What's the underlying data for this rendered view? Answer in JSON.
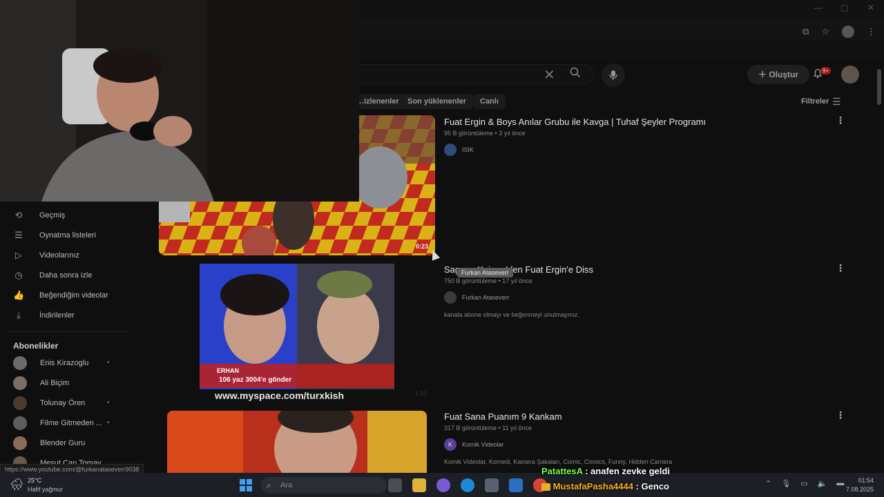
{
  "window": {
    "minimize": "—",
    "maximize": "▢",
    "close": "✕"
  },
  "search": {
    "clear_icon": "✕",
    "search_icon": "⌕"
  },
  "header": {
    "create_label": "Oluştur",
    "notifications_badge": "9+"
  },
  "filter_chips": [
    "…izlenenler",
    "Son yüklenenler",
    "Canlı"
  ],
  "filters_label": "Filtreler",
  "sidebar": {
    "items": [
      {
        "icon": "history-icon",
        "glyph": "⟲",
        "label": "Geçmiş"
      },
      {
        "icon": "playlist-icon",
        "glyph": "☰",
        "label": "Oynatma listeleri"
      },
      {
        "icon": "your-videos-icon",
        "glyph": "▷",
        "label": "Videolarınız"
      },
      {
        "icon": "watch-later-icon",
        "glyph": "◷",
        "label": "Daha sonra izle"
      },
      {
        "icon": "like-icon",
        "glyph": "👍",
        "label": "Beğendiğim videolar"
      },
      {
        "icon": "download-icon",
        "glyph": "⤓",
        "label": "İndirilenler"
      }
    ],
    "subscriptions_header": "Abonelikler",
    "subscriptions": [
      {
        "name": "Enis Kirazoglu",
        "dot": "•",
        "color": "#6b6b6b"
      },
      {
        "name": "Ali Biçim",
        "dot": "",
        "color": "#7a6f66"
      },
      {
        "name": "Tolunay Ören",
        "dot": "•",
        "color": "#4b3a2f"
      },
      {
        "name": "Filme Gitmeden ...",
        "dot": "•",
        "color": "#5d5d5d"
      },
      {
        "name": "Blender Guru",
        "dot": "",
        "color": "#8a6a58"
      },
      {
        "name": "Mesut Can Tomay",
        "dot": "",
        "color": "#6a5a4a"
      }
    ]
  },
  "videos": [
    {
      "title": "Fuat Ergin & Boys Anılar Grubu ile Kavga | Tuhaf Şeyler Programı",
      "meta": "95 B görüntüleme • 3 yıl önce",
      "channel": "ISIK",
      "duration": "0:23",
      "description": ""
    },
    {
      "title": "Sagopa Kajmer'den Fuat Ergin'e Diss",
      "meta": "750 B görüntüleme • 17 yıl önce",
      "channel": "Furkan Ataseverr",
      "duration": "1:50",
      "description": "kanala abone olmayı ve beğenmeyi unutmayınız.",
      "thumb_caption_name": "ERHAN",
      "thumb_caption_sms": "106 yaz 3004'e gönder",
      "thumb_url": "www.myspace.com/turxkish"
    },
    {
      "title": "Fuat Sana Puanım 9 Kankam",
      "meta": "317 B görüntüleme • 11 yıl önce",
      "channel": "Komik Videolar",
      "channel_initial": "K",
      "duration": "",
      "description": "Komik Videolar, Komedi, Kamera Şakaları, Comic, Comics, Funny, Hidden Camera"
    }
  ],
  "tooltip": "Furkan Ataseverr",
  "status_url": "https://www.youtube.com/@furkanataseverr9038",
  "weather": {
    "temp": "25°C",
    "desc": "Hafif yağmur"
  },
  "taskbar": {
    "search_placeholder": "Ara"
  },
  "chat": [
    {
      "user": "PatattesA",
      "message": "anafen zevke geldi",
      "color": "#7cff4a"
    },
    {
      "user": "MustafaPasha4444",
      "message": "Genco",
      "color": "#ffb020"
    }
  ],
  "clock": {
    "time": "01:54",
    "date": "7.08.2025"
  }
}
